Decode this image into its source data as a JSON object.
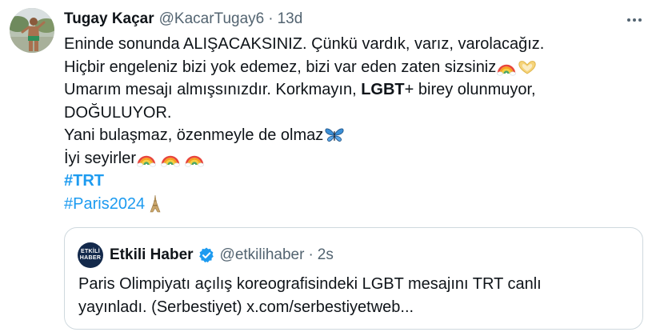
{
  "author": {
    "name": "Tugay Kaçar",
    "handle": "@KacarTugay6",
    "separator": "·",
    "time": "13d"
  },
  "tweet": {
    "line1": "Eninde sonunda ALIŞACAKSINIZ. Çünkü vardık, varız, varolacağız.",
    "line2": "Hiçbir engeleniz bizi yok edemez, bizi var eden zaten sizsiniz",
    "line3_before": "Umarım mesajı almışsınızdır. Korkmayın, ",
    "line3_bold": "LGBT",
    "line3_after": "+ birey olunmuyor,",
    "line4": "DOĞULUYOR.",
    "line5": "Yani bulaşmaz, özenmeyle de olmaz",
    "line6": "İyi seyirler",
    "hashtag1": "#TRT",
    "hashtag2": "#Paris2024"
  },
  "quote": {
    "logo_line1": "ETKİLİ",
    "logo_line2": "HABER",
    "name": "Etkili Haber",
    "handle": "@etkilihaber",
    "separator": "·",
    "time": "2s",
    "line1": "Paris Olimpiyatı açılış koreografisindeki LGBT mesajını TRT canlı",
    "line2": "yayınladı. (Serbestiyet) x.com/serbestiyetweb..."
  },
  "icons": {
    "more": "more-horizontal-icon",
    "rainbow": "rainbow-emoji",
    "heart_hands": "heart-hands-emoji",
    "butterfly": "butterfly-emoji",
    "eiffel": "eiffel-tower-emoji",
    "verified": "verified-badge-icon"
  },
  "colors": {
    "link": "#1d9bf0",
    "secondary_text": "#536471",
    "border": "#cfd9de",
    "text": "#0f1419"
  }
}
